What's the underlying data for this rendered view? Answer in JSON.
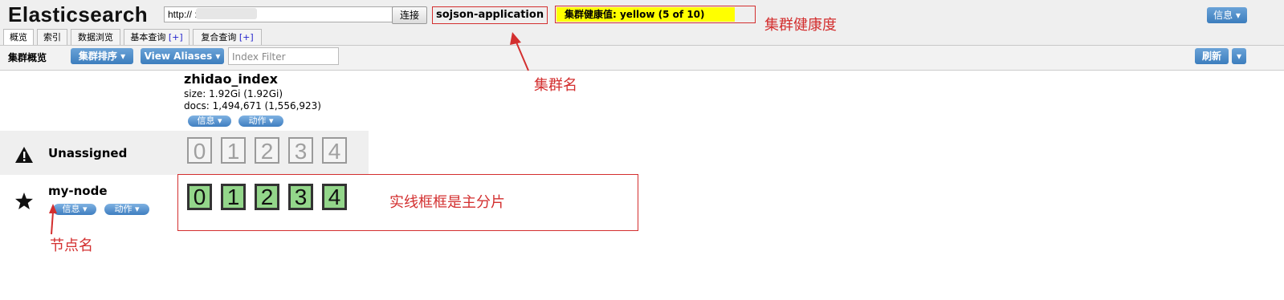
{
  "app": {
    "title": "Elasticsearch"
  },
  "connection": {
    "url": "http://          :9200/",
    "connect_label": "连接",
    "cluster_name": "sojson-application",
    "health": "集群健康值: yellow (5 of 10)",
    "info_label": "信息 ▾"
  },
  "tabs": [
    {
      "label": "概览"
    },
    {
      "label": "索引"
    },
    {
      "label": "数据浏览"
    },
    {
      "label": "基本查询",
      "plus": "[+]"
    },
    {
      "label": "复合查询",
      "plus": "[+]"
    }
  ],
  "toolbar": {
    "title": "集群概览",
    "sort_label": "集群排序 ▾",
    "aliases_label": "View Aliases ▾",
    "filter_placeholder": "Index Filter",
    "refresh_label": "刷新",
    "refresh_menu": "▾"
  },
  "index": {
    "name": "zhidao_index",
    "size": "size: 1.92Gi (1.92Gi)",
    "docs": "docs: 1,494,671 (1,556,923)",
    "info_label": "信息 ▾",
    "action_label": "动作 ▾"
  },
  "rows": {
    "unassigned": {
      "label": "Unassigned",
      "icon": "warning-icon",
      "shards": [
        "0",
        "1",
        "2",
        "3",
        "4"
      ]
    },
    "node": {
      "label": "my-node",
      "icon": "star-icon",
      "info_label": "信息 ▾",
      "action_label": "动作 ▾",
      "shards": [
        "0",
        "1",
        "2",
        "3",
        "4"
      ]
    }
  },
  "annotations": {
    "health": "集群健康度",
    "cluster_name": "集群名",
    "primary": "实线框框是主分片",
    "node_name": "节点名"
  },
  "colors": {
    "health_yellow": "#ffff00",
    "primary_shard": "#93d68a",
    "annotation_red": "#d32f2f",
    "button_blue": "#3c7dbd"
  }
}
